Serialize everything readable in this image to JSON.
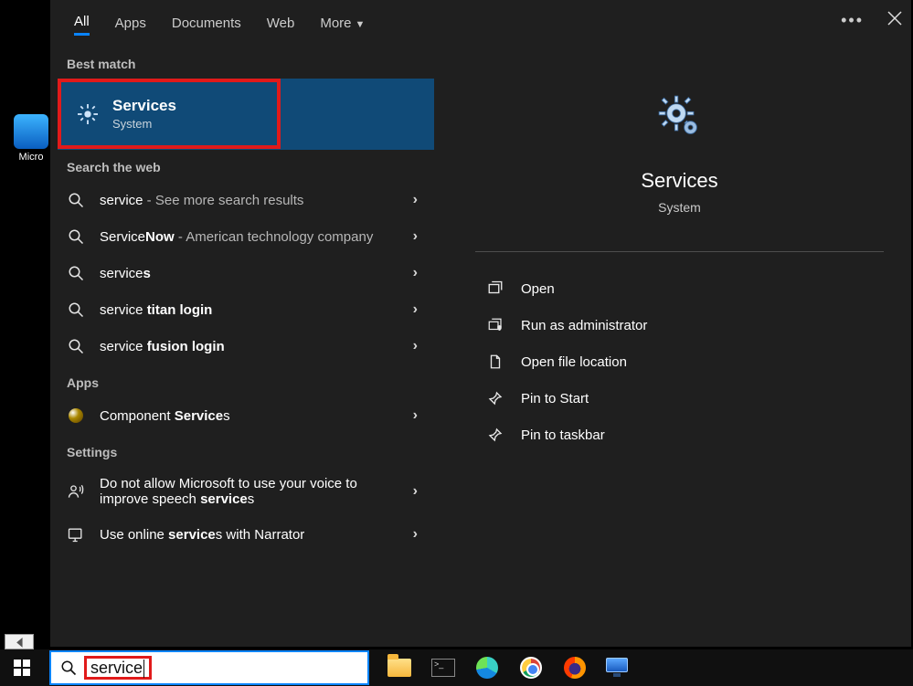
{
  "tabs": {
    "all": "All",
    "apps": "Apps",
    "documents": "Documents",
    "web": "Web",
    "more": "More"
  },
  "sections": {
    "best": "Best match",
    "web": "Search the web",
    "apps": "Apps",
    "settings": "Settings"
  },
  "best_match": {
    "title": "Services",
    "subtitle": "System"
  },
  "web_results": [
    {
      "prefix": "service",
      "suffix": " - See more search results"
    },
    {
      "prefix": "Service",
      "bold": "Now",
      "suffix": " - American technology company"
    },
    {
      "prefix": "service",
      "bold": "s",
      "suffix": ""
    },
    {
      "prefix": "service ",
      "bold": "titan login",
      "suffix": ""
    },
    {
      "prefix": "service ",
      "bold": "fusion login",
      "suffix": ""
    }
  ],
  "apps_results": [
    {
      "prefix": "Component ",
      "bold": "Service",
      "suffix": "s"
    }
  ],
  "settings_results": [
    {
      "prefix": "Do not allow Microsoft to use your voice to improve speech ",
      "bold": "service",
      "suffix": "s"
    },
    {
      "prefix": "Use online ",
      "bold": "service",
      "suffix": "s with Narrator"
    }
  ],
  "preview": {
    "title": "Services",
    "subtitle": "System"
  },
  "actions": {
    "open": "Open",
    "run_admin": "Run as administrator",
    "open_loc": "Open file location",
    "pin_start": "Pin to Start",
    "pin_taskbar": "Pin to taskbar"
  },
  "search_query": "service",
  "desktop_icon_label": "Micro"
}
